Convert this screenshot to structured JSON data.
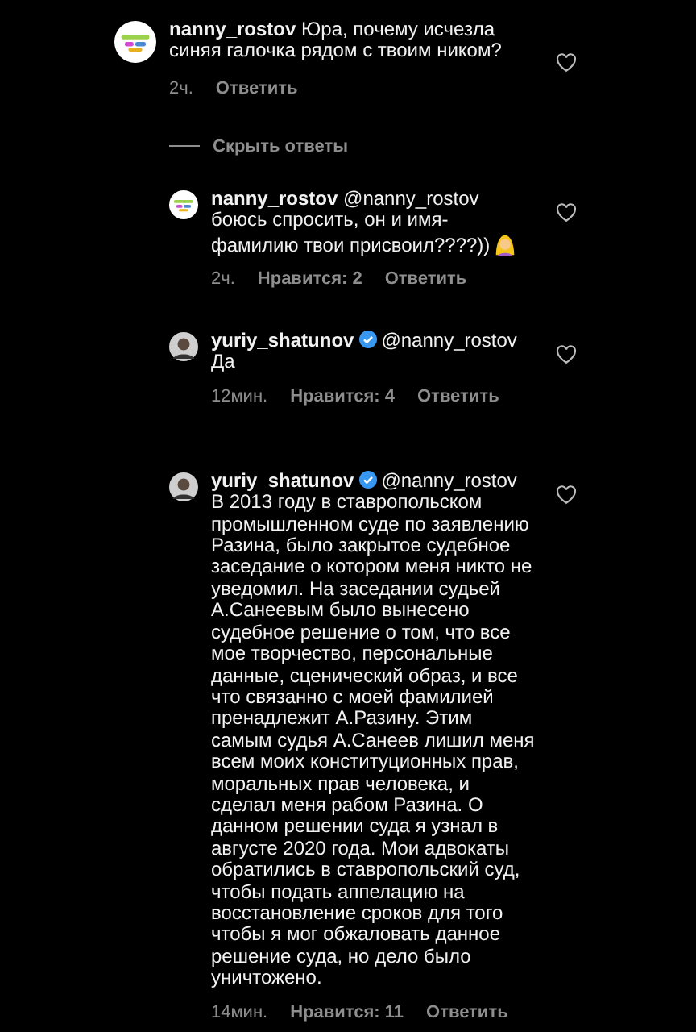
{
  "comment": {
    "kind": "logo",
    "username": "nanny_rostov",
    "verified": false,
    "text": "Юра, почему исчезла синяя галочка рядом с твоим ником?",
    "time": "2ч.",
    "reply": "Ответить"
  },
  "replies_toggle": "Скрыть ответы",
  "replies": [
    {
      "kind": "logo",
      "username": "nanny_rostov",
      "verified": false,
      "text": "@nanny_rostov боюсь спросить, он и имя-фамилию твои присвоил????))",
      "emoji": true,
      "time": "2ч.",
      "likes": "Нравится: 2",
      "reply": "Ответить"
    },
    {
      "kind": "person",
      "username": "yuriy_shatunov",
      "verified": true,
      "text": "@nanny_rostov Да",
      "emoji": false,
      "time": "12мин.",
      "likes": "Нравится: 4",
      "reply": "Ответить"
    },
    {
      "kind": "person",
      "username": "yuriy_shatunov",
      "verified": true,
      "text": "@nanny_rostov В 2013 году в ставропольском промышленном суде по заявлению Разина, было закрытое судебное заседание о котором меня никто не уведомил. На заседании судьей А.Санеевым было вынесено судебное решение о том, что все мое творчество, персональные данные, сценический образ, и все что связанно с моей фамилией пренадлежит А.Разину. Этим самым судья А.Санеев лишил меня всем моих конституционных прав, моральных прав человека, и сделал меня рабом Разина. О данном решении суда я узнал в августе 2020 года. Мои адвокаты обратились в ставропольский суд, чтобы подать аппелацию на восстановление сроков для того чтобы я мог обжаловать данное решение суда, но дело было уничтожено.",
      "emoji": false,
      "time": "14мин.",
      "likes": "Нравится: 11",
      "reply": "Ответить"
    }
  ]
}
